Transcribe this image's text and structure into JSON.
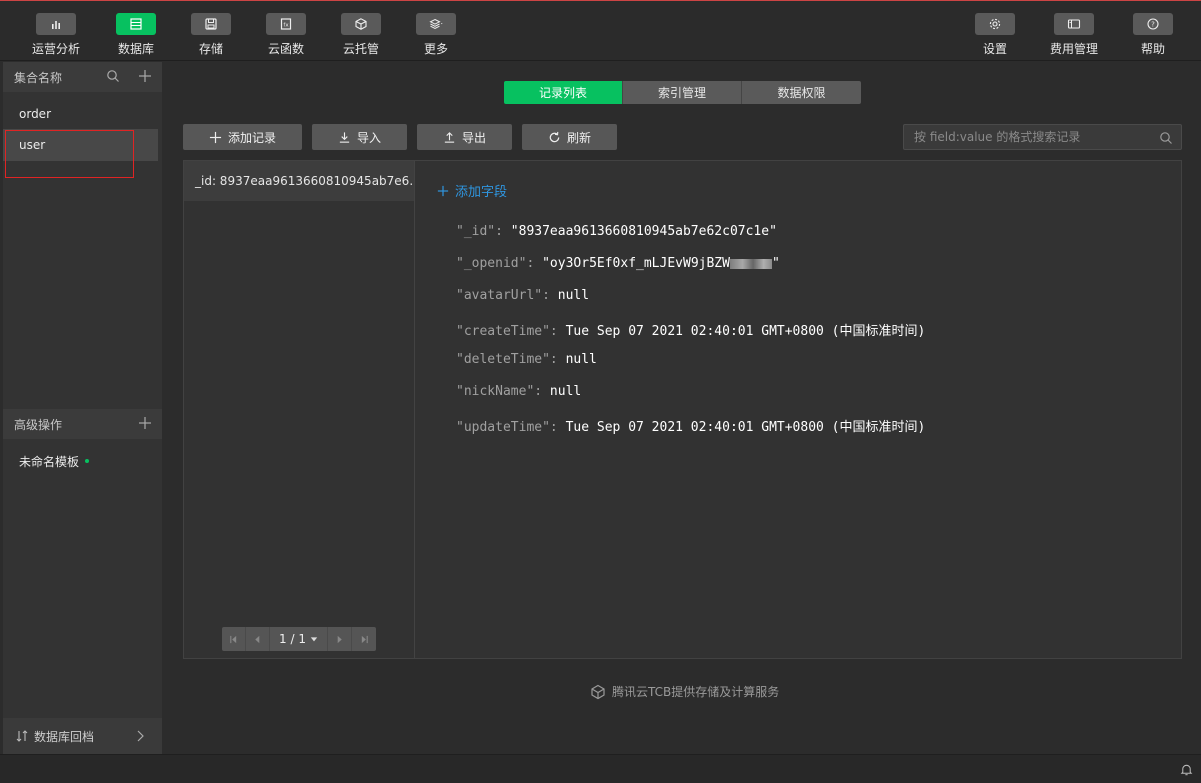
{
  "toolbar": {
    "left": [
      {
        "label": "运营分析",
        "icon": "bar-chart-icon"
      },
      {
        "label": "数据库",
        "icon": "database-icon",
        "active": true
      },
      {
        "label": "存储",
        "icon": "save-icon"
      },
      {
        "label": "云函数",
        "icon": "function-icon"
      },
      {
        "label": "云托管",
        "icon": "cube-icon"
      },
      {
        "label": "更多",
        "icon": "layers-icon"
      }
    ],
    "right": [
      {
        "label": "设置",
        "icon": "gear-icon"
      },
      {
        "label": "费用管理",
        "icon": "billing-icon"
      },
      {
        "label": "帮助",
        "icon": "help-icon"
      }
    ]
  },
  "sidebar": {
    "collections_header": "集合名称",
    "collections": [
      {
        "name": "order"
      },
      {
        "name": "user",
        "selected": true
      }
    ],
    "advanced_header": "高级操作",
    "templates": [
      {
        "name": "未命名模板"
      }
    ],
    "footer_label": "数据库回档"
  },
  "tabs": [
    {
      "label": "记录列表",
      "active": true
    },
    {
      "label": "索引管理"
    },
    {
      "label": "数据权限"
    }
  ],
  "actions": {
    "add_record": "添加记录",
    "import": "导入",
    "export": "导出",
    "refresh": "刷新"
  },
  "search": {
    "placeholder": "按 field:value 的格式搜索记录"
  },
  "records": [
    {
      "label": "_id: 8937eaa9613660810945ab7e6..."
    }
  ],
  "pager": {
    "text": "1 / 1"
  },
  "detail": {
    "add_field": "添加字段",
    "fields": [
      {
        "key": "\"_id\":",
        "value": "\"8937eaa9613660810945ab7e62c07c1e\""
      },
      {
        "key": "\"_openid\":",
        "value": "\"oy3Or5Ef0xf_mLJEvW9jBZW",
        "value_end": "\"",
        "redacted": true
      },
      {
        "key": "\"avatarUrl\":",
        "value": "null"
      },
      {
        "key": "\"createTime\":",
        "value": "Tue Sep 07 2021 02:40:01 GMT+0800 (中国标准时间)"
      },
      {
        "key": "\"deleteTime\":",
        "value": "null"
      },
      {
        "key": "\"nickName\":",
        "value": "null"
      },
      {
        "key": "\"updateTime\":",
        "value": "Tue Sep 07 2021 02:40:01 GMT+0800 (中国标准时间)"
      }
    ]
  },
  "footer_note": "腾讯云TCB提供存储及计算服务",
  "colors": {
    "accent": "#07c160",
    "link": "#2f96e0",
    "highlight": "#e02424"
  }
}
